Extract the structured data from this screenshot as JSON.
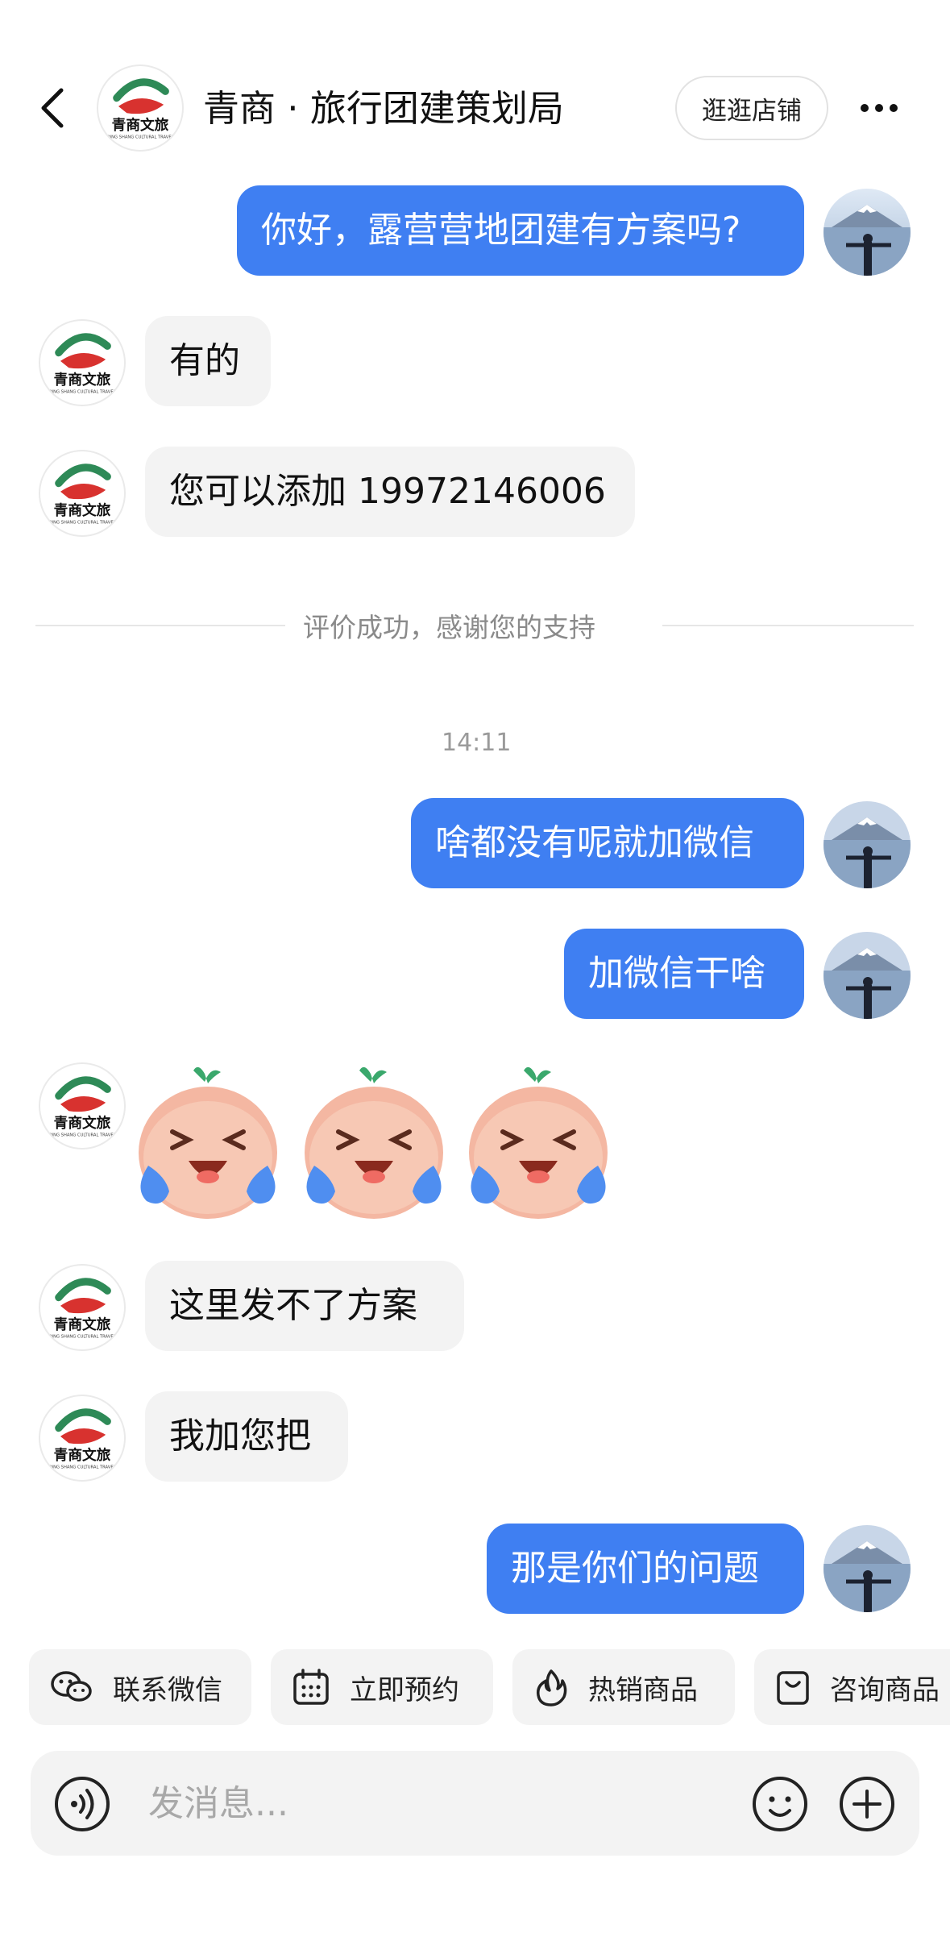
{
  "header": {
    "title": "青商 · 旅行团建策划局",
    "shop_button": "逛逛店铺",
    "shop_logo_text": "青商文旅",
    "shop_logo_subtext": "QING SHANG CULTURAL TRAVEL"
  },
  "messages": {
    "m1": "你好，露营营地团建有方案吗?",
    "m2": "有的",
    "m3": "您可以添加 19972146006",
    "m4": "啥都没有呢就加微信",
    "m5": "加微信干啥",
    "m7": "这里发不了方案",
    "m8": "我加您把",
    "m9": "那是你们的问题"
  },
  "system": {
    "review_notice": "评价成功，感谢您的支持",
    "timestamp": "14:11"
  },
  "quick_actions": [
    {
      "label": "联系微信",
      "icon": "wechat-icon"
    },
    {
      "label": "立即预约",
      "icon": "calendar-icon"
    },
    {
      "label": "热销商品",
      "icon": "flame-icon"
    },
    {
      "label": "咨询商品",
      "icon": "bag-icon"
    }
  ],
  "input": {
    "placeholder": "发消息..."
  },
  "colors": {
    "accent": "#3f7ff2",
    "bubble_other": "#f3f3f3"
  }
}
